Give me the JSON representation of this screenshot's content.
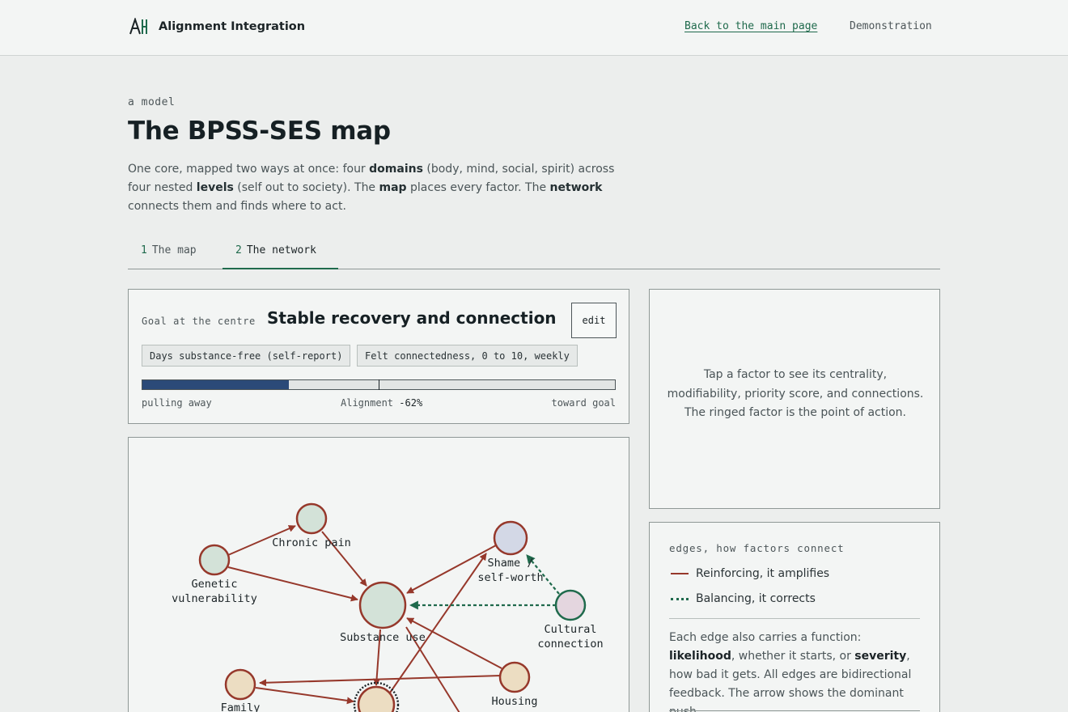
{
  "header": {
    "brand": "Alignment Integration",
    "nav": [
      {
        "label": "Back to the main page"
      },
      {
        "label": "Demonstration"
      }
    ]
  },
  "hero": {
    "eyebrow": "a model",
    "title": "The BPSS-SES map",
    "intro": {
      "t1": "One core, mapped two ways at once: four ",
      "b1": "domains",
      "t2": " (body, mind, social, spirit) across four nested ",
      "b2": "levels",
      "t3": " (self out to society). The ",
      "b3": "map",
      "t4": " places every factor. The ",
      "b4": "network",
      "t5": " connects them and finds where to act."
    }
  },
  "tabs": [
    {
      "num": "1",
      "label": "The map",
      "active": false
    },
    {
      "num": "2",
      "label": "The network",
      "active": true
    }
  ],
  "goal": {
    "label": "Goal at the centre",
    "title": "Stable recovery and connection",
    "edit_label": "edit",
    "measures": [
      "Days substance-free (self-report)",
      "Felt connectedness, 0 to 10, weekly"
    ],
    "alignment_label": "Alignment",
    "alignment_value": "-62%",
    "alignment_fraction": -0.62,
    "left_label": "pulling away",
    "right_label": "toward goal"
  },
  "network": {
    "nodes": [
      {
        "id": "chronic-pain",
        "label": [
          "Chronic pain"
        ],
        "fill": "#d3e2d8"
      },
      {
        "id": "genetic",
        "label": [
          "Genetic",
          "vulnerability"
        ],
        "fill": "#d3e2d8"
      },
      {
        "id": "substance",
        "label": [
          "Substance use"
        ],
        "fill": "#d3e2d8"
      },
      {
        "id": "shame",
        "label": [
          "Shame /",
          "self-worth"
        ],
        "fill": "#d3d8e6"
      },
      {
        "id": "cultural",
        "label": [
          "Cultural",
          "connection"
        ],
        "fill": "#e4d6df"
      },
      {
        "id": "family",
        "label": [
          "Family"
        ],
        "fill": "#ecddc2"
      },
      {
        "id": "housing",
        "label": [
          "Housing"
        ],
        "fill": "#ecddc2"
      },
      {
        "id": "action",
        "label": [],
        "fill": "#ecddc2"
      }
    ],
    "colors": {
      "reinforcing": "#96382b",
      "balancing": "#1f6a4c",
      "node_stroke": "#96382b",
      "balancing_stroke": "#1f6a4c"
    }
  },
  "info": {
    "placeholder": "Tap a factor to see its centrality, modifiability, priority score, and connections. The ringed factor is the point of action."
  },
  "edges": {
    "heading": "edges, how factors connect",
    "legend": [
      {
        "label": "Reinforcing, it amplifies"
      },
      {
        "label": "Balancing, it corrects"
      }
    ],
    "body": {
      "t1": "Each edge also carries a function: ",
      "b1": "likelihood",
      "t2": ", whether it starts, or ",
      "b2": "severity",
      "t3": ", how bad it gets. All edges are bidirectional feedback. The arrow shows the dominant push."
    }
  }
}
